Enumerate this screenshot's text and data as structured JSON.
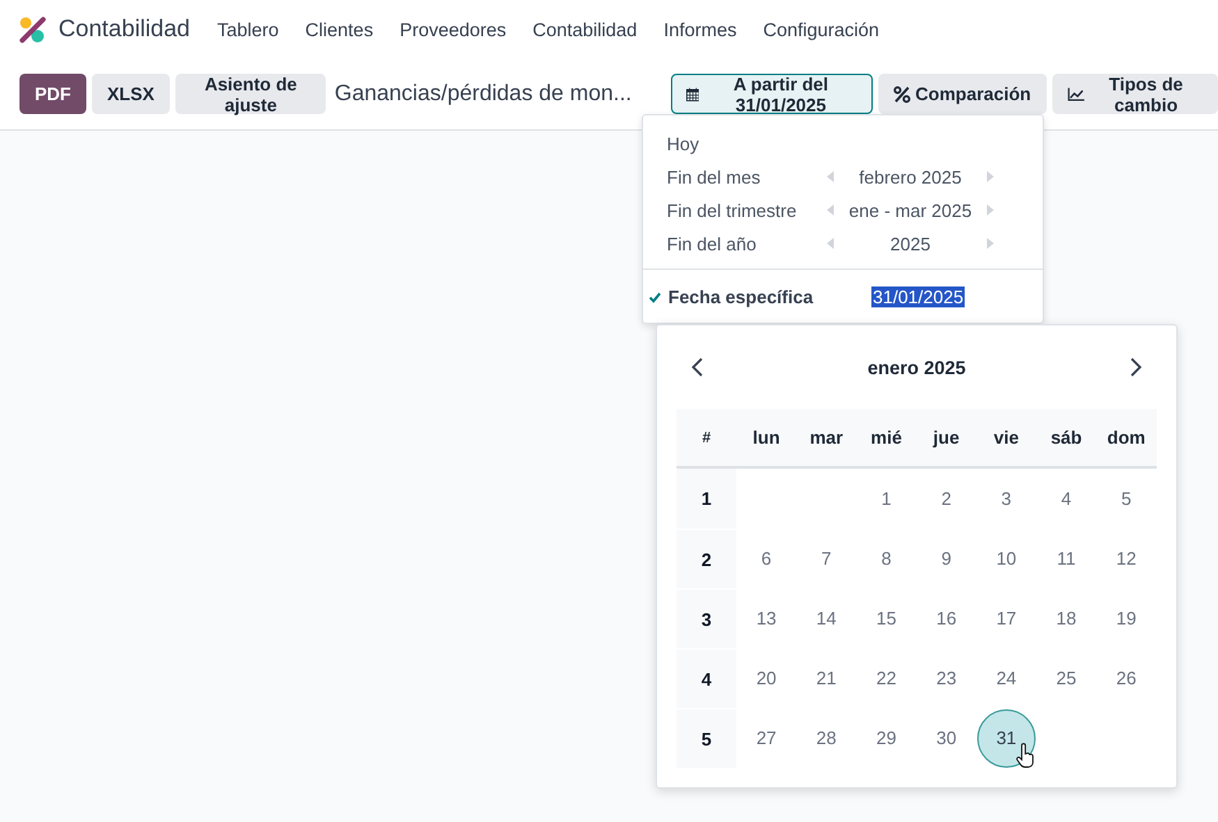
{
  "app": {
    "name": "Contabilidad"
  },
  "menu": [
    "Tablero",
    "Clientes",
    "Proveedores",
    "Contabilidad",
    "Informes",
    "Configuración"
  ],
  "toolbar": {
    "buttons": [
      {
        "label": "PDF",
        "kind": "primary"
      },
      {
        "label": "XLSX",
        "kind": "secondary"
      },
      {
        "label": "Asiento de ajuste",
        "kind": "secondary"
      }
    ],
    "report_title": "Ganancias/pérdidas de mon...",
    "filters": [
      {
        "label": "A partir del 31/01/2025",
        "kind": "calendar",
        "selected": true
      },
      {
        "label": "Comparación",
        "kind": "percent",
        "selected": false
      },
      {
        "label": "Tipos de cambio",
        "kind": "chart",
        "selected": false
      }
    ]
  },
  "date_menu": {
    "options": [
      {
        "label": "Hoy",
        "checked": false
      },
      {
        "label": "Fin del mes",
        "value": "febrero 2025",
        "checked": false
      },
      {
        "label": "Fin del trimestre",
        "value": "ene - mar 2025",
        "checked": false
      },
      {
        "label": "Fin del año",
        "value": "2025",
        "checked": false
      }
    ],
    "specific": {
      "label": "Fecha específica",
      "checked": true,
      "value": "31/01/2025"
    }
  },
  "calendar": {
    "month": "enero 2025",
    "week_header": "#",
    "weekdays": [
      "lun",
      "mar",
      "mié",
      "jue",
      "vie",
      "sáb",
      "dom"
    ],
    "weeks": [
      {
        "number": "1",
        "days": [
          {
            "label": "1",
            "selected": false
          },
          {
            "label": "2",
            "selected": false
          },
          {
            "label": "3",
            "selected": false
          },
          {
            "label": "4",
            "selected": false
          },
          {
            "label": "5",
            "selected": false
          }
        ]
      },
      {
        "number": "2",
        "days": [
          {
            "label": "6",
            "selected": false
          },
          {
            "label": "7",
            "selected": false
          },
          {
            "label": "8",
            "selected": false
          },
          {
            "label": "9",
            "selected": false
          },
          {
            "label": "10",
            "selected": false
          },
          {
            "label": "11",
            "selected": false
          },
          {
            "label": "12",
            "selected": false
          }
        ]
      },
      {
        "number": "3",
        "days": [
          {
            "label": "13",
            "selected": false
          },
          {
            "label": "14",
            "selected": false
          },
          {
            "label": "15",
            "selected": false
          },
          {
            "label": "16",
            "selected": false
          },
          {
            "label": "17",
            "selected": false
          },
          {
            "label": "18",
            "selected": false
          },
          {
            "label": "19",
            "selected": false
          }
        ]
      },
      {
        "number": "4",
        "days": [
          {
            "label": "20",
            "selected": false
          },
          {
            "label": "21",
            "selected": false
          },
          {
            "label": "22",
            "selected": false
          },
          {
            "label": "23",
            "selected": false
          },
          {
            "label": "24",
            "selected": false
          },
          {
            "label": "25",
            "selected": false
          },
          {
            "label": "26",
            "selected": false
          }
        ]
      },
      {
        "number": "5",
        "days": [
          {
            "label": "27",
            "selected": false
          },
          {
            "label": "28",
            "selected": false
          },
          {
            "label": "29",
            "selected": false
          },
          {
            "label": "30",
            "selected": false
          },
          {
            "label": "31",
            "selected": true
          }
        ]
      }
    ]
  }
}
